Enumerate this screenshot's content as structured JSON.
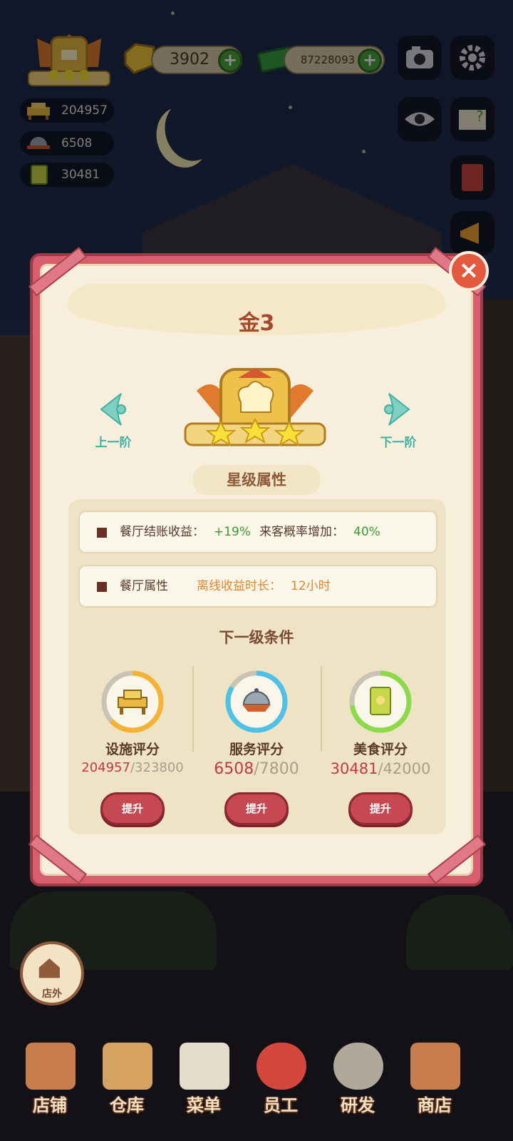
{
  "hud": {
    "gems": "3902",
    "cash": "87228093",
    "facility_score": "204957",
    "service_score": "6508",
    "food_score": "30481"
  },
  "dialog": {
    "title": "金3",
    "prev_label": "上一阶",
    "next_label": "下一阶",
    "star_section": "星级属性",
    "attr1_label": "餐厅结账收益：",
    "attr1_value": "+19%",
    "attr1b_label": "来客概率增加：",
    "attr1b_value": "40%",
    "attr2_label": "餐厅属性",
    "attr2b_label": "离线收益时长：",
    "attr2b_value": "12小时",
    "next_conditions": "下一级条件",
    "scores": [
      {
        "label": "设施评分",
        "current": "204957",
        "target": "/323800",
        "progress": 0.633,
        "color": "#f5b335",
        "button": "提升",
        "icon": "facility-icon"
      },
      {
        "label": "服务评分",
        "current": "6508",
        "target": "/7800",
        "progress": 0.834,
        "color": "#4fc0e6",
        "button": "提升",
        "icon": "service-icon"
      },
      {
        "label": "美食评分",
        "current": "30481",
        "target": "/42000",
        "progress": 0.726,
        "color": "#8cd94a",
        "button": "提升",
        "icon": "recipe-book-icon"
      }
    ]
  },
  "outside_label": "店外",
  "bottom_nav": [
    "店铺",
    "仓库",
    "菜单",
    "员工",
    "研发",
    "商店"
  ],
  "colors": {
    "frame": "#d75e6c",
    "title": "#a4492e",
    "accent": "#3fb0a3"
  }
}
